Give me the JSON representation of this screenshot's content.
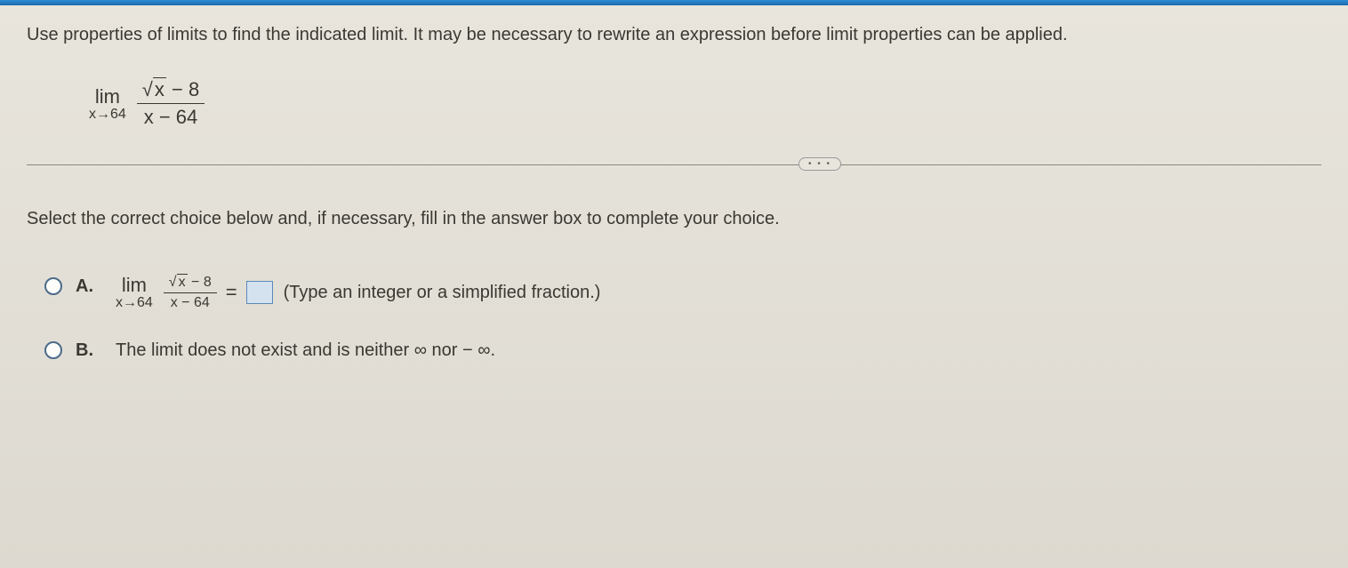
{
  "question": {
    "prompt": "Use properties of limits to find the indicated limit. It may be necessary to rewrite an expression before limit properties can be applied.",
    "limit": {
      "lim_label": "lim",
      "approach": "x→64",
      "numerator_sqrt_arg": "x",
      "numerator_rest": " − 8",
      "denominator": "x − 64"
    }
  },
  "divider": {
    "dots": "• • •"
  },
  "instruction": "Select the correct choice below and, if necessary, fill in the answer box to complete your choice.",
  "choices": {
    "a": {
      "label": "A.",
      "limit": {
        "lim_label": "lim",
        "approach": "x→64",
        "numerator_sqrt_arg": "x",
        "numerator_rest": " − 8",
        "denominator": "x − 64"
      },
      "equals": "=",
      "hint": "(Type an integer or a simplified fraction.)"
    },
    "b": {
      "label": "B.",
      "text": "The limit does not exist and is neither ∞ nor − ∞."
    }
  }
}
